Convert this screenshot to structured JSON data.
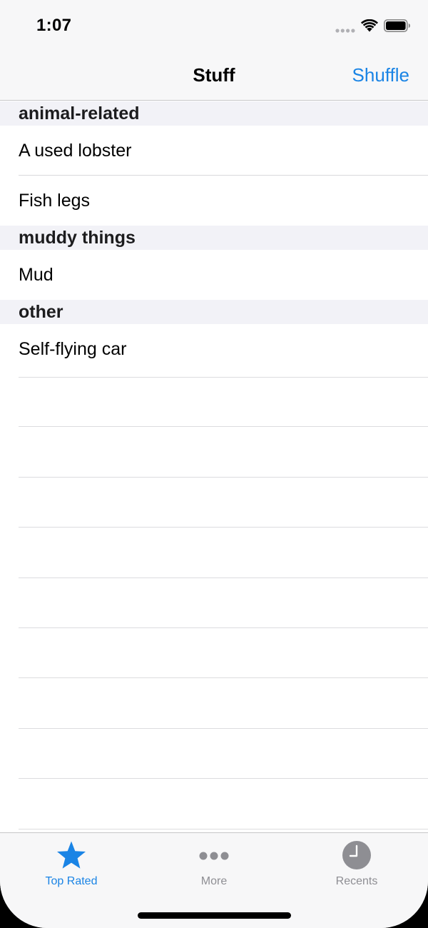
{
  "status": {
    "time": "1:07"
  },
  "nav": {
    "title": "Stuff",
    "right_button": "Shuffle"
  },
  "sections": [
    {
      "header": "animal-related",
      "rows": [
        "A used lobster",
        "Fish legs"
      ]
    },
    {
      "header": "muddy things",
      "rows": [
        "Mud"
      ]
    },
    {
      "header": "other",
      "rows": [
        "Self-flying car"
      ]
    }
  ],
  "tabs": [
    {
      "label": "Top Rated",
      "icon": "star-icon",
      "active": true
    },
    {
      "label": "More",
      "icon": "more-icon",
      "active": false
    },
    {
      "label": "Recents",
      "icon": "clock-icon",
      "active": false
    }
  ],
  "colors": {
    "accent": "#1a84e5",
    "inactive": "#8e8e93"
  }
}
